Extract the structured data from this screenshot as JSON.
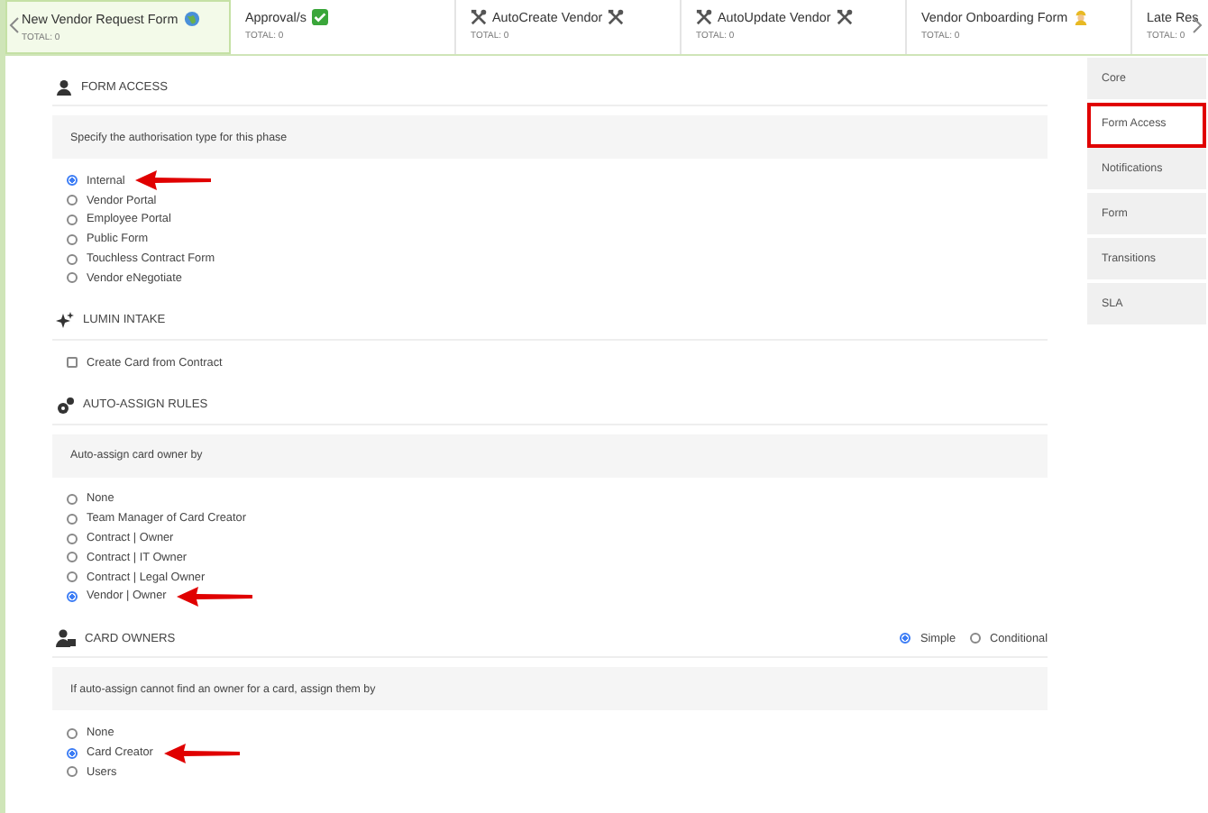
{
  "tabs": [
    {
      "label": "New Vendor Request Form",
      "total": "TOTAL: 0",
      "kind": "globe",
      "selected": true
    },
    {
      "label": "Approval/s",
      "total": "TOTAL: 0",
      "kind": "check",
      "selected": false
    },
    {
      "label": "AutoCreate Vendor",
      "total": "TOTAL: 0",
      "kind": "tools",
      "selected": false
    },
    {
      "label": "AutoUpdate Vendor",
      "total": "TOTAL: 0",
      "kind": "tools",
      "selected": false
    },
    {
      "label": "Vendor Onboarding Form",
      "total": "TOTAL: 0",
      "kind": "worker",
      "selected": false
    },
    {
      "label": "Late Res",
      "total": "TOTAL: 0",
      "kind": "plain",
      "selected": false
    }
  ],
  "sections": [
    {
      "title": "FORM ACCESS",
      "kind": "radio",
      "hint": "Specify the authorisation type for this phase",
      "options": [
        {
          "label": "Internal",
          "selected": true,
          "annotated": true
        },
        {
          "label": "Vendor Portal",
          "selected": false,
          "annotated": false
        },
        {
          "label": "Employee Portal",
          "selected": false,
          "annotated": false
        },
        {
          "label": "Public Form",
          "selected": false,
          "annotated": false
        },
        {
          "label": "Touchless Contract Form",
          "selected": false,
          "annotated": false
        },
        {
          "label": "Vendor eNegotiate",
          "selected": false,
          "annotated": false
        }
      ]
    },
    {
      "title": "LUMIN INTAKE",
      "kind": "checkbox",
      "options": [
        {
          "label": "Create Card from Contract",
          "checked": false
        }
      ]
    },
    {
      "title": "AUTO-ASSIGN RULES",
      "kind": "radio",
      "hint": "Auto-assign card owner by",
      "options": [
        {
          "label": "None",
          "selected": false,
          "annotated": false
        },
        {
          "label": "Team Manager of Card Creator",
          "selected": false,
          "annotated": false
        },
        {
          "label": "Contract | Owner",
          "selected": false,
          "annotated": false
        },
        {
          "label": "Contract | IT Owner",
          "selected": false,
          "annotated": false
        },
        {
          "label": "Contract | Legal Owner",
          "selected": false,
          "annotated": false
        },
        {
          "label": "Vendor | Owner",
          "selected": true,
          "annotated": true
        }
      ]
    },
    {
      "title": "CARD OWNERS",
      "kind": "radio",
      "hint": "If auto-assign cannot find an owner for a card, assign them by",
      "modes": [
        {
          "label": "Simple",
          "selected": true
        },
        {
          "label": "Conditional",
          "selected": false
        }
      ],
      "options": [
        {
          "label": "None",
          "selected": false,
          "annotated": false
        },
        {
          "label": "Card Creator",
          "selected": true,
          "annotated": true
        },
        {
          "label": "Users",
          "selected": false,
          "annotated": false
        }
      ]
    }
  ],
  "sidebar": {
    "items": [
      {
        "label": "Core",
        "selected": false
      },
      {
        "label": "Form Access",
        "selected": true
      },
      {
        "label": "Notifications",
        "selected": false
      },
      {
        "label": "Form",
        "selected": false
      },
      {
        "label": "Transitions",
        "selected": false
      },
      {
        "label": "SLA",
        "selected": false
      }
    ]
  }
}
